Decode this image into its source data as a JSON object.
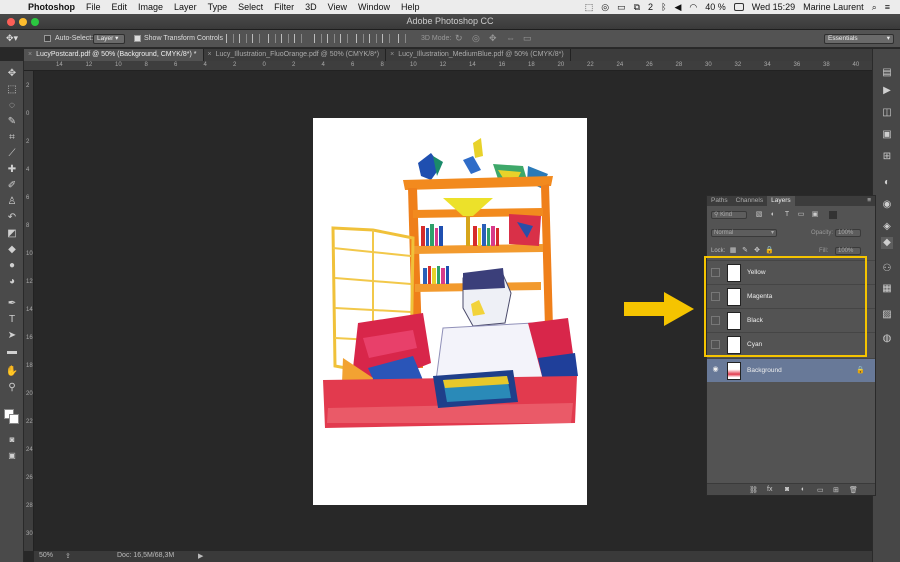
{
  "menubar": {
    "app": "Photoshop",
    "menus": [
      "File",
      "Edit",
      "Image",
      "Layer",
      "Type",
      "Select",
      "Filter",
      "3D",
      "View",
      "Window",
      "Help"
    ],
    "badge_count": "2",
    "battery": "40 %",
    "clock": "Wed 15:29",
    "user": "Marine Laurent"
  },
  "window": {
    "title": "Adobe Photoshop CC"
  },
  "options": {
    "auto_select_label": "Auto-Select:",
    "auto_select_value": "Layer",
    "show_transform_label": "Show Transform Controls",
    "mode_3d_label": "3D Mode:",
    "workspace": "Essentials"
  },
  "doc_tabs": [
    {
      "label": "LucyPostcard.pdf @ 50% (Background, CMYK/8*) *",
      "active": true
    },
    {
      "label": "Lucy_Illustration_FluoOrange.pdf @ 50% (CMYK/8*)",
      "active": false
    },
    {
      "label": "Lucy_Illustration_MediumBlue.pdf @ 50% (CMYK/8*)",
      "active": false
    }
  ],
  "ruler": {
    "h_labels": [
      "14",
      "12",
      "10",
      "8",
      "6",
      "4",
      "2",
      "0",
      "2",
      "4",
      "6",
      "8",
      "10",
      "12",
      "14",
      "16",
      "18",
      "20",
      "22",
      "24",
      "26",
      "28",
      "30",
      "32",
      "34",
      "36",
      "38",
      "40"
    ],
    "v_labels": [
      "2",
      "0",
      "2",
      "4",
      "6",
      "8",
      "10",
      "12",
      "14",
      "16",
      "18",
      "20",
      "22",
      "24",
      "26",
      "28",
      "30"
    ]
  },
  "statusbar": {
    "zoom": "50%",
    "doc": "Doc: 16,5M/68,3M"
  },
  "layers_panel": {
    "tabs": [
      "Paths",
      "Channels",
      "Layers"
    ],
    "active_tab": "Layers",
    "filter_kind": "Kind",
    "blend_mode": "Normal",
    "opacity_label": "Opacity:",
    "opacity_value": "100%",
    "lock_label": "Lock:",
    "fill_label": "Fill:",
    "fill_value": "100%",
    "layers": [
      {
        "name": "Yellow",
        "visible": false,
        "selected": false,
        "locked": false
      },
      {
        "name": "Magenta",
        "visible": false,
        "selected": false,
        "locked": false
      },
      {
        "name": "Black",
        "visible": false,
        "selected": false,
        "locked": false
      },
      {
        "name": "Cyan",
        "visible": false,
        "selected": false,
        "locked": false
      },
      {
        "name": "Background",
        "visible": true,
        "selected": true,
        "locked": true
      }
    ]
  },
  "colors": {
    "highlight": "#f5c400",
    "arrow": "#f5c400",
    "selected_layer": "#687998"
  }
}
